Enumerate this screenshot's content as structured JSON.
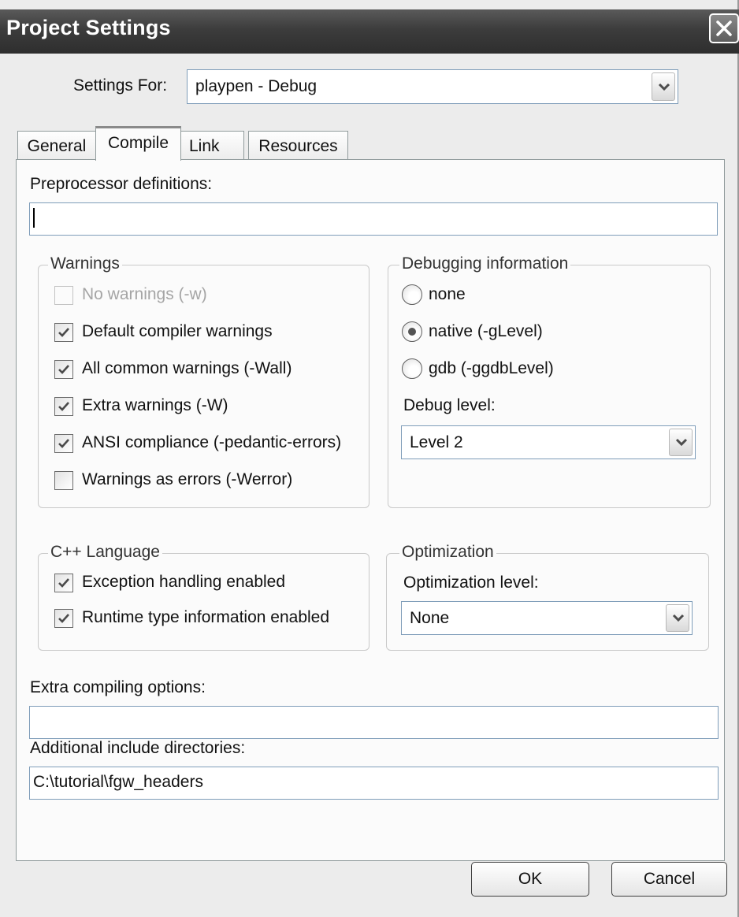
{
  "window": {
    "title": "Project Settings"
  },
  "settings_for": {
    "label": "Settings For:",
    "value": "playpen - Debug"
  },
  "tabs": [
    {
      "label": "General",
      "active": false
    },
    {
      "label": "Compile",
      "active": true
    },
    {
      "label": "Link",
      "active": false
    },
    {
      "label": "Resources",
      "active": false
    }
  ],
  "compile": {
    "preprocessor_label": "Preprocessor definitions:",
    "preprocessor_value": "",
    "warnings": {
      "title": "Warnings",
      "items": [
        {
          "label": "No warnings (-w)",
          "checked": false,
          "enabled": false
        },
        {
          "label": "Default compiler warnings",
          "checked": true,
          "enabled": true
        },
        {
          "label": "All common warnings (-Wall)",
          "checked": true,
          "enabled": true
        },
        {
          "label": "Extra warnings (-W)",
          "checked": true,
          "enabled": true
        },
        {
          "label": "ANSI compliance (-pedantic-errors)",
          "checked": true,
          "enabled": true
        },
        {
          "label": "Warnings as errors (-Werror)",
          "checked": false,
          "enabled": true
        }
      ]
    },
    "debugging": {
      "title": "Debugging information",
      "options": [
        {
          "label": "none",
          "selected": false
        },
        {
          "label": "native (-gLevel)",
          "selected": true
        },
        {
          "label": "gdb (-ggdbLevel)",
          "selected": false
        }
      ],
      "level_label": "Debug level:",
      "level_value": "Level 2"
    },
    "cpp_language": {
      "title": "C++ Language",
      "items": [
        {
          "label": "Exception handling enabled",
          "checked": true
        },
        {
          "label": "Runtime type information enabled",
          "checked": true
        }
      ]
    },
    "optimization": {
      "title": "Optimization",
      "level_label": "Optimization level:",
      "level_value": "None"
    },
    "extra_options_label": "Extra compiling options:",
    "extra_options_value": "",
    "include_dirs_label": "Additional include directories:",
    "include_dirs_value": "C:\\tutorial\\fgw_headers"
  },
  "buttons": {
    "ok": "OK",
    "cancel": "Cancel"
  },
  "icons": {
    "close": "close-icon",
    "dropdown": "chevron-down-icon",
    "check": "checkmark-icon"
  }
}
